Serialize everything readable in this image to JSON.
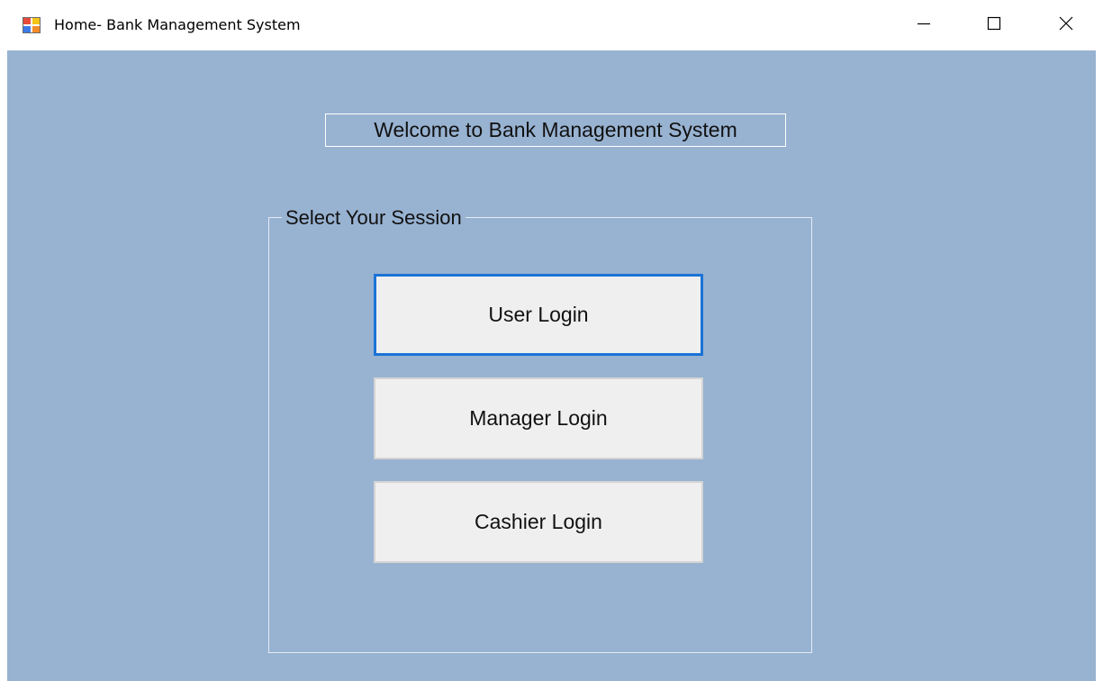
{
  "window": {
    "title": "Home- Bank Management System",
    "icon": "app-form-icon",
    "controls": {
      "minimize": "minimize-icon",
      "maximize": "maximize-icon",
      "close": "close-icon"
    }
  },
  "form": {
    "welcome_label": "Welcome to Bank Management System",
    "session_group": {
      "title": "Select Your Session",
      "buttons": [
        {
          "label": "User Login",
          "focused": true
        },
        {
          "label": "Manager Login",
          "focused": false
        },
        {
          "label": "Cashier Login",
          "focused": false
        }
      ]
    }
  },
  "colors": {
    "form_background": "#98b2d1",
    "button_background": "#efefef",
    "focus_border": "#1a73d6"
  }
}
